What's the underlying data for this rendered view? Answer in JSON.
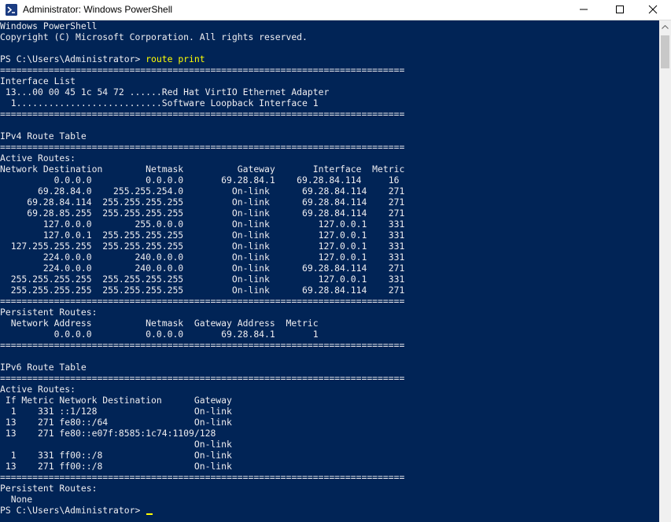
{
  "window": {
    "title": "Administrator: Windows PowerShell",
    "icon": "powershell-icon",
    "controls": [
      "minimize-icon",
      "maximize-icon",
      "close-icon"
    ]
  },
  "colors": {
    "console_background": "#012456",
    "console_text": "#eeedf0",
    "command_text": "#ffff00"
  },
  "console": {
    "lines": [
      {
        "text": "Windows PowerShell"
      },
      {
        "text": "Copyright (C) Microsoft Corporation. All rights reserved."
      },
      {
        "text": ""
      },
      {
        "text": "PS C:\\Users\\Administrator> ",
        "command": "route print"
      },
      {
        "text": "==========================================================================="
      },
      {
        "text": "Interface List"
      },
      {
        "text": " 13...00 00 45 1c 54 72 ......Red Hat VirtIO Ethernet Adapter"
      },
      {
        "text": "  1...........................Software Loopback Interface 1"
      },
      {
        "text": "==========================================================================="
      },
      {
        "text": ""
      },
      {
        "text": "IPv4 Route Table"
      },
      {
        "text": "==========================================================================="
      },
      {
        "text": "Active Routes:"
      },
      {
        "text": "Network Destination        Netmask          Gateway       Interface  Metric"
      },
      {
        "text": "          0.0.0.0          0.0.0.0       69.28.84.1    69.28.84.114     16"
      },
      {
        "text": "       69.28.84.0    255.255.254.0         On-link      69.28.84.114    271"
      },
      {
        "text": "     69.28.84.114  255.255.255.255         On-link      69.28.84.114    271"
      },
      {
        "text": "     69.28.85.255  255.255.255.255         On-link      69.28.84.114    271"
      },
      {
        "text": "        127.0.0.0        255.0.0.0         On-link         127.0.0.1    331"
      },
      {
        "text": "        127.0.0.1  255.255.255.255         On-link         127.0.0.1    331"
      },
      {
        "text": "  127.255.255.255  255.255.255.255         On-link         127.0.0.1    331"
      },
      {
        "text": "        224.0.0.0        240.0.0.0         On-link         127.0.0.1    331"
      },
      {
        "text": "        224.0.0.0        240.0.0.0         On-link      69.28.84.114    271"
      },
      {
        "text": "  255.255.255.255  255.255.255.255         On-link         127.0.0.1    331"
      },
      {
        "text": "  255.255.255.255  255.255.255.255         On-link      69.28.84.114    271"
      },
      {
        "text": "==========================================================================="
      },
      {
        "text": "Persistent Routes:"
      },
      {
        "text": "  Network Address          Netmask  Gateway Address  Metric"
      },
      {
        "text": "          0.0.0.0          0.0.0.0       69.28.84.1       1"
      },
      {
        "text": "==========================================================================="
      },
      {
        "text": ""
      },
      {
        "text": "IPv6 Route Table"
      },
      {
        "text": "==========================================================================="
      },
      {
        "text": "Active Routes:"
      },
      {
        "text": " If Metric Network Destination      Gateway"
      },
      {
        "text": "  1    331 ::1/128                  On-link"
      },
      {
        "text": " 13    271 fe80::/64                On-link"
      },
      {
        "text": " 13    271 fe80::e07f:8585:1c74:1109/128"
      },
      {
        "text": "                                    On-link"
      },
      {
        "text": "  1    331 ff00::/8                 On-link"
      },
      {
        "text": " 13    271 ff00::/8                 On-link"
      },
      {
        "text": "==========================================================================="
      },
      {
        "text": "Persistent Routes:"
      },
      {
        "text": "  None"
      },
      {
        "text": "PS C:\\Users\\Administrator> ",
        "cursor": true
      }
    ]
  }
}
